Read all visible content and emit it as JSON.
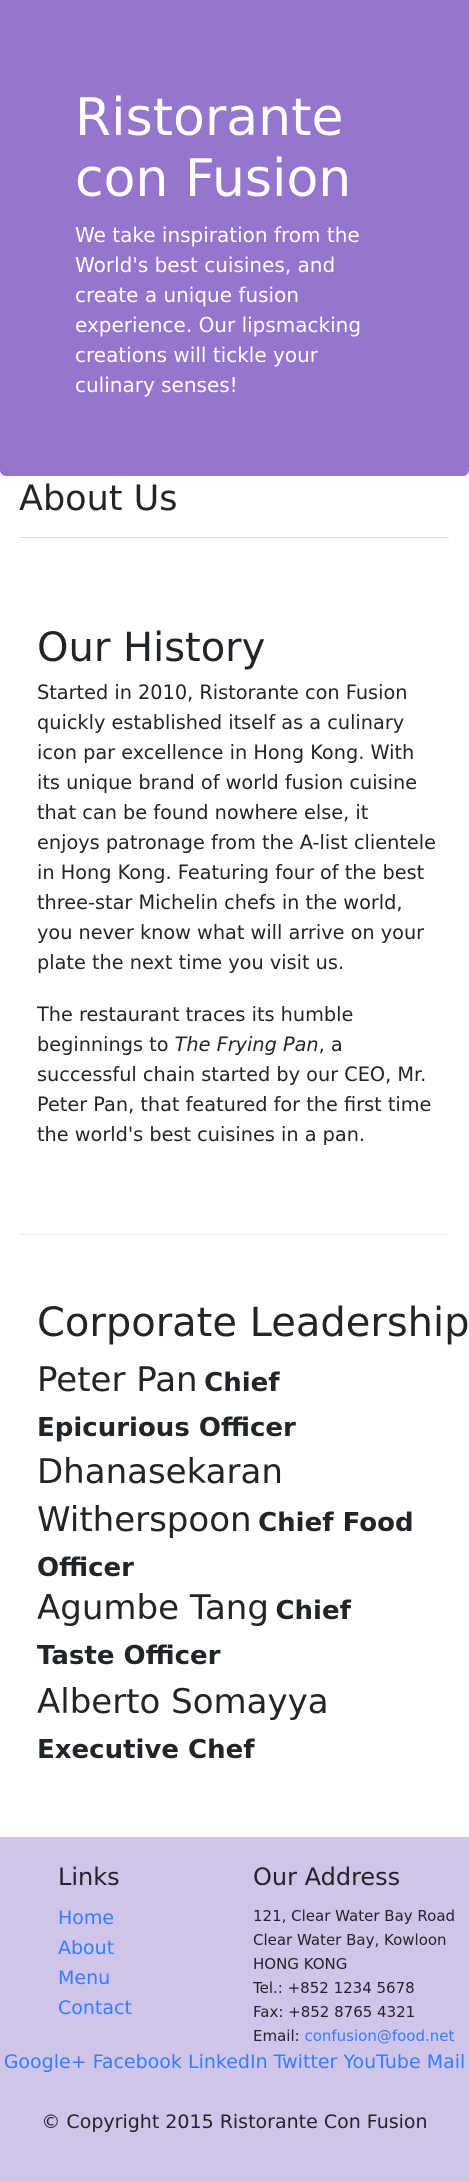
{
  "jumbotron": {
    "title": "Ristorante con Fusion",
    "tagline": "We take inspiration from the World's best cuisines, and create a unique fusion experience. Our lipsmacking creations will tickle your culinary senses!"
  },
  "page": {
    "heading": "About Us"
  },
  "history": {
    "heading": "Our History",
    "paragraph1": "Started in 2010, Ristorante con Fusion quickly established itself as a culinary icon par excellence in Hong Kong. With its unique brand of world fusion cuisine that can be found nowhere else, it enjoys patronage from the A-list clientele in Hong Kong. Featuring four of the best three-star Michelin chefs in the world, you never know what will arrive on your plate the next time you visit us.",
    "paragraph2_before": "The restaurant traces its humble beginnings to ",
    "paragraph2_emphasis": "The Frying Pan",
    "paragraph2_after": ", a successful chain started by our CEO, Mr. Peter Pan, that featured for the first time the world's best cuisines in a pan."
  },
  "leadership": {
    "heading": "Corporate Leadership",
    "leaders": [
      {
        "name": "Peter Pan",
        "role": "Chief Epicurious Officer"
      },
      {
        "name": "Dhanasekaran Witherspoon",
        "role": "Chief Food Officer"
      },
      {
        "name": "Agumbe Tang",
        "role": "Chief Taste Officer"
      },
      {
        "name": "Alberto Somayya",
        "role": "Executive Chef"
      }
    ]
  },
  "footer": {
    "links_heading": "Links",
    "links": [
      "Home",
      "About",
      "Menu",
      "Contact"
    ],
    "address_heading": "Our Address",
    "address_lines": [
      "121, Clear Water Bay Road",
      "Clear Water Bay, Kowloon",
      "HONG KONG"
    ],
    "tel": "Tel.: +852 1234 5678",
    "fax": "Fax: +852 8765 4321",
    "email_label": "Email: ",
    "email": "confusion@food.net",
    "social": [
      "Google+",
      "Facebook",
      "LinkedIn",
      "Twitter",
      "YouTube",
      "Mail"
    ],
    "copyright": "© Copyright 2015 Ristorante Con Fusion"
  },
  "colors": {
    "jumbotron_bg": "#9575cd",
    "footer_bg": "#d1c4e9",
    "link": "#2f7fff",
    "text": "#212529"
  }
}
